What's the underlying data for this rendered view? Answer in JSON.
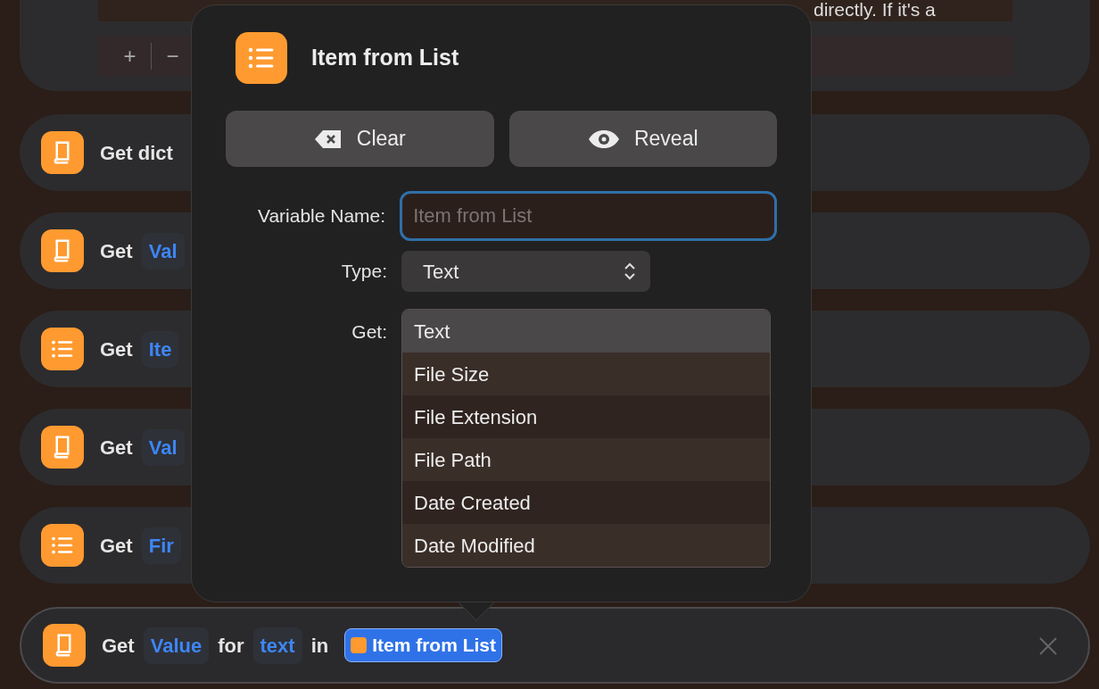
{
  "top_card": {
    "text": "directly. If it's a",
    "toolbar": [
      "+",
      "−"
    ]
  },
  "actions": [
    {
      "kind": "dictionary",
      "text": "Get dict"
    },
    {
      "kind": "dictionary",
      "text": "Get",
      "token": "Val"
    },
    {
      "kind": "list",
      "text": "Get",
      "token": "Ite"
    },
    {
      "kind": "dictionary",
      "text": "Get",
      "token": "Val"
    },
    {
      "kind": "list",
      "text": "Get",
      "token": "Fir"
    }
  ],
  "current_action": {
    "kind": "dictionary",
    "selected": true,
    "parts": [
      {
        "kind": "word",
        "text": "Get"
      },
      {
        "kind": "token",
        "text": "Value"
      },
      {
        "kind": "word",
        "text": "for"
      },
      {
        "kind": "token",
        "text": "text"
      },
      {
        "kind": "word",
        "text": "in"
      },
      {
        "kind": "variable",
        "text": "Item from List"
      }
    ]
  },
  "popover": {
    "title": "Item from List",
    "buttons": [
      {
        "label": "Clear"
      },
      {
        "label": "Reveal"
      }
    ],
    "variable_name": {
      "label": "Variable Name:",
      "placeholder": "Item from List",
      "focused": true
    },
    "type": {
      "label": "Type:",
      "value": "Text"
    },
    "get": {
      "label": "Get:",
      "options": [
        {
          "label": "Text",
          "selected": true
        },
        {
          "label": "File Size",
          "selected": false
        },
        {
          "label": "File Extension",
          "selected": false
        },
        {
          "label": "File Path",
          "selected": false
        },
        {
          "label": "Date Created",
          "selected": false
        },
        {
          "label": "Date Modified",
          "selected": false
        }
      ]
    }
  }
}
